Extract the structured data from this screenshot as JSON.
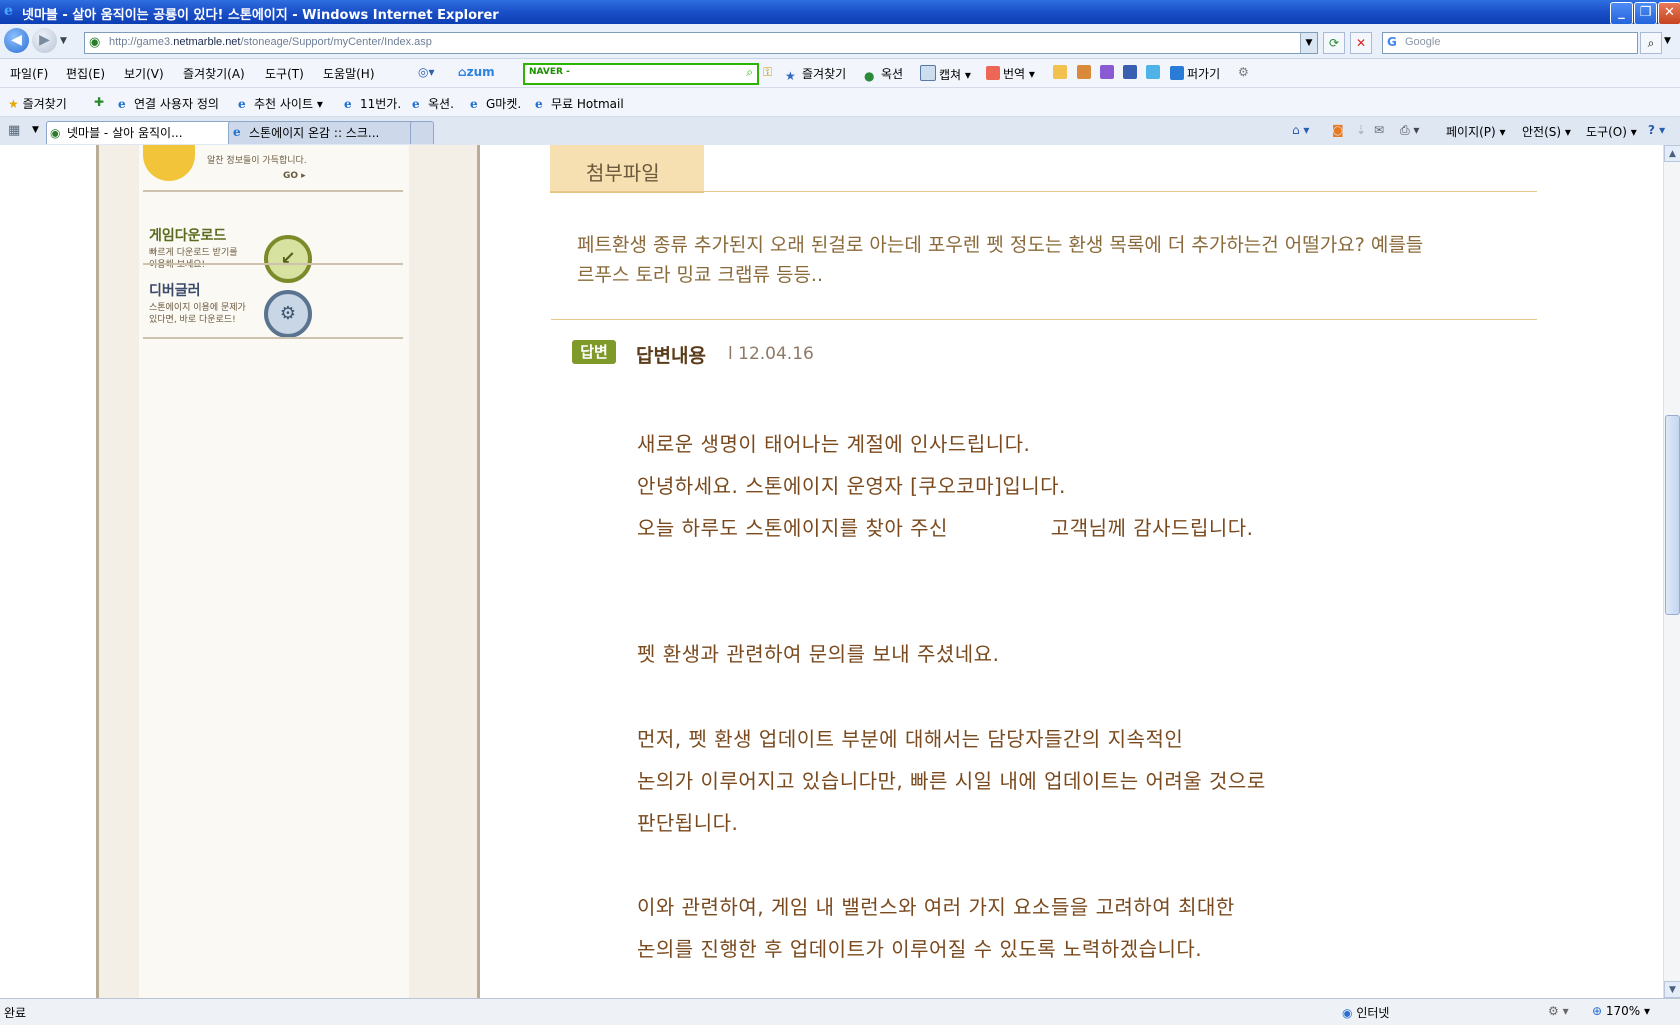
{
  "window": {
    "title": "넷마블 - 살아 움직이는 공룡이 있다! 스톤에이지 - Windows Internet Explorer",
    "minimize": "_",
    "maximize": "❐",
    "close": "✕"
  },
  "address": {
    "url_prefix": "http://game3.",
    "url_domain": "netmarble.net",
    "url_path": "/stoneage/Support/myCenter/Index.asp",
    "search_placeholder": "Google"
  },
  "menu": [
    "파일(F)",
    "편집(E)",
    "보기(V)",
    "즐겨찾기(A)",
    "도구(T)",
    "도움말(H)"
  ],
  "toolbar": {
    "zum": "zum",
    "naver": "NAVER -",
    "favorites": "즐겨찾기",
    "auction": "옥션",
    "capture": "캡쳐",
    "translate": "번역",
    "scrap": "퍼가기"
  },
  "favorites_bar": {
    "label": "즐겨찾기",
    "items": [
      "연결 사용자 정의",
      "추천 사이트",
      "11번가.",
      "옥션.",
      "G마켓.",
      "무료 Hotmail"
    ]
  },
  "tabs": [
    {
      "label": "넷마블 - 살아 움직이..."
    },
    {
      "label": "스톤에이지 온감 :: 스크..."
    }
  ],
  "commands": {
    "page": "페이지(P)",
    "safety": "안전(S)",
    "tools": "도구(O)"
  },
  "sidebar": {
    "top_desc": "알찬 정보들이 가득합니다.",
    "top_go": "GO ▸",
    "items": [
      {
        "title": "게임다운로드",
        "desc1": "빠르게 다운로드 받기를",
        "desc2": "이용해 보세요!"
      },
      {
        "title": "디버글러",
        "desc1": "스톤에이지 이용에 문제가",
        "desc2": "있다면, 바로 다운로드!"
      }
    ]
  },
  "attachment": {
    "tab_label": "첨부파일"
  },
  "question": {
    "line1": "페트환생 종류 추가된지 오래 된걸로 아는데 포우렌 펫 정도는 환생 목록에 더 추가하는건 어떨가요? 예를들",
    "line2": "르푸스 토라 밍쿄 크랩류 등등.."
  },
  "answer": {
    "badge": "답변",
    "title": "답변내용",
    "date": "l 12.04.16",
    "lines": [
      "새로운 생명이 태어나는 계절에 인사드립니다.",
      "안녕하세요. 스톤에이지 운영자 [쿠오코마]입니다.",
      "오늘 하루도 스톤에이지를 찾아 주신               고객님께 감사드립니다.",
      "펫 환생과 관련하여 문의를 보내 주셨네요.",
      "먼저, 펫 환생 업데이트 부분에 대해서는 담당자들간의 지속적인",
      "논의가 이루어지고 있습니다만, 빠른 시일 내에 업데이트는 어려울 것으로",
      "판단됩니다.",
      "이와 관련하여, 게임 내 밸런스와 여러 가지 요소들을 고려하여 최대한",
      "논의를 진행한 후 업데이트가 이루어질 수 있도록 노력하겠습니다."
    ]
  },
  "status": {
    "left": "완료",
    "zone": "인터넷",
    "zoom": "170%"
  }
}
